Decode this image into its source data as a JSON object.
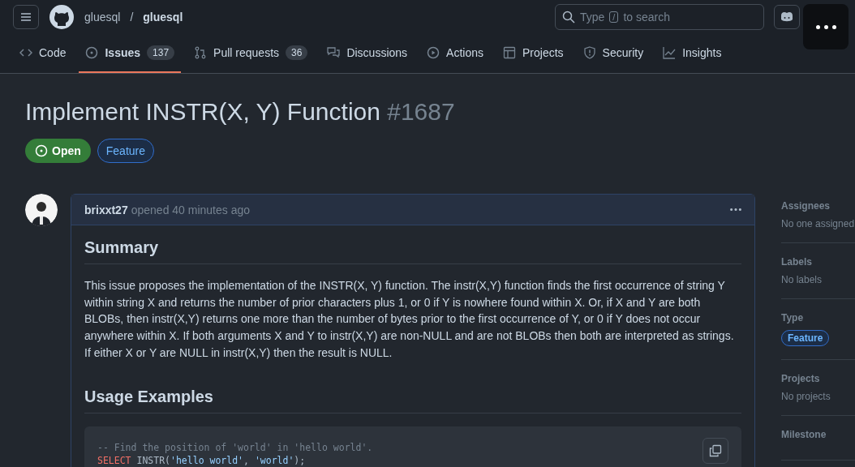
{
  "header": {
    "owner": "gluesql",
    "separator": "/",
    "repo": "gluesql",
    "search_prefix": "Type",
    "search_key": "/",
    "search_suffix": "to search"
  },
  "tabs": [
    {
      "label": "Code",
      "selected": false
    },
    {
      "label": "Issues",
      "count": "137",
      "selected": true
    },
    {
      "label": "Pull requests",
      "count": "36",
      "selected": false
    },
    {
      "label": "Discussions",
      "selected": false
    },
    {
      "label": "Actions",
      "selected": false
    },
    {
      "label": "Projects",
      "selected": false
    },
    {
      "label": "Security",
      "selected": false
    },
    {
      "label": "Insights",
      "selected": false
    }
  ],
  "issue": {
    "title": "Implement INSTR(X, Y) Function",
    "number": "#1687",
    "state": "Open",
    "label": "Feature"
  },
  "comment": {
    "author": "brixxt27",
    "meta": "opened 40 minutes ago",
    "heading_1": "Summary",
    "paragraph": "This issue proposes the implementation of the INSTR(X, Y) function. The instr(X,Y) function finds the first occurrence of string Y within string X and returns the number of prior characters plus 1, or 0 if Y is nowhere found within X. Or, if X and Y are both BLOBs, then instr(X,Y) returns one more than the number of bytes prior to the first occurrence of Y, or 0 if Y does not occur anywhere within X. If both arguments X and Y to instr(X,Y) are non-NULL and are not BLOBs then both are interpreted as strings. If either X or Y are NULL in instr(X,Y) then the result is NULL.",
    "heading_2": "Usage Examples",
    "code": [
      [
        {
          "kind": "comment",
          "text": "-- Find the position of 'world' in 'hello world'."
        }
      ],
      [
        {
          "kind": "keyword",
          "text": "SELECT"
        },
        {
          "kind": "plain",
          "text": " INSTR("
        },
        {
          "kind": "string",
          "text": "'hello world'"
        },
        {
          "kind": "plain",
          "text": ", "
        },
        {
          "kind": "string",
          "text": "'world'"
        },
        {
          "kind": "plain",
          "text": ");"
        }
      ]
    ]
  },
  "sidebar": [
    {
      "title": "Assignees",
      "value": "No one assigned",
      "kind": "text"
    },
    {
      "title": "Labels",
      "value": "No labels",
      "kind": "text"
    },
    {
      "title": "Type",
      "value": "Feature",
      "kind": "pill"
    },
    {
      "title": "Projects",
      "value": "No projects",
      "kind": "text"
    },
    {
      "title": "Milestone"
    }
  ]
}
